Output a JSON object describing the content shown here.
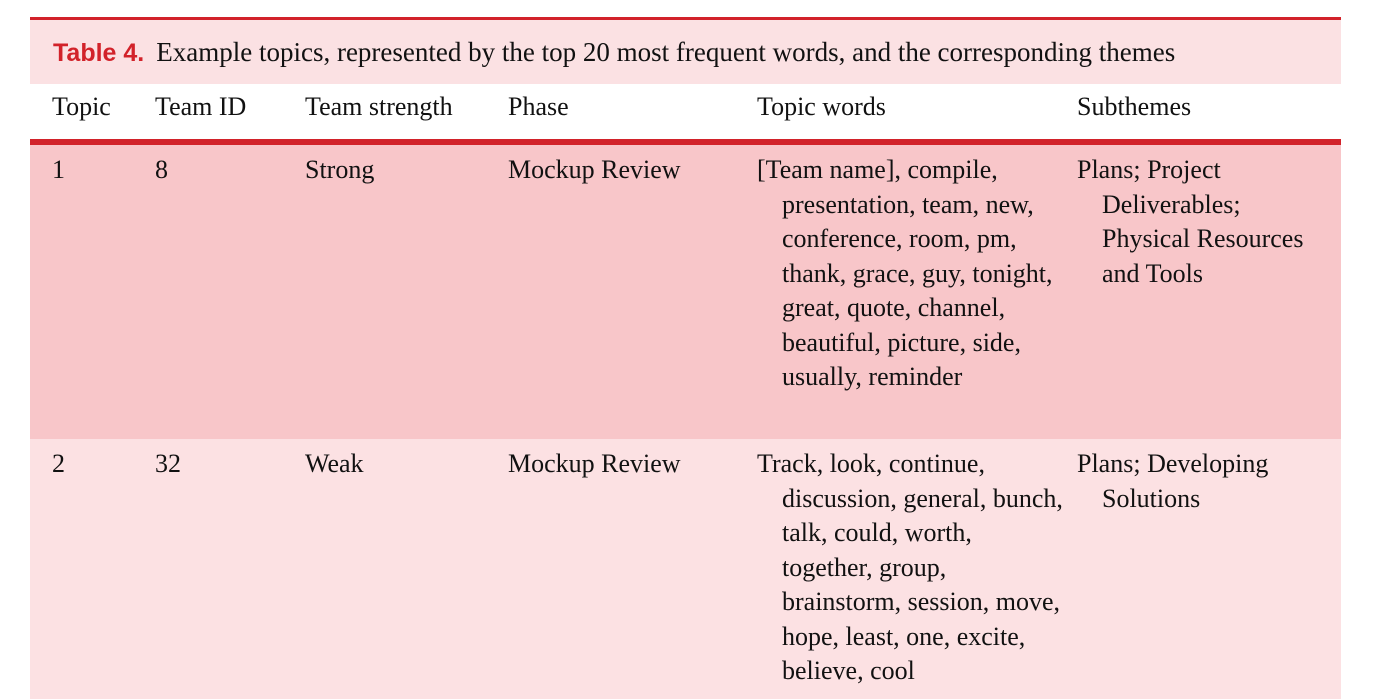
{
  "caption": {
    "label": "Table 4.",
    "text": "Example topics, represented by the top 20 most frequent words, and the corresponding themes"
  },
  "colors": {
    "accent_red": "#d2222a",
    "caption_bg": "#fbe1e3",
    "row_odd_bg": "#f8c6c9",
    "row_even_bg": "#fce1e3"
  },
  "columns": [
    "Topic",
    "Team ID",
    "Team strength",
    "Phase",
    "Topic words",
    "Subthemes"
  ],
  "rows": [
    {
      "topic": "1",
      "team_id": "8",
      "team_strength": "Strong",
      "phase": "Mockup Review",
      "topic_words": "[Team name], compile, presentation, team, new, conference, room, pm, thank, grace, guy, tonight, great, quote, channel, beautiful, picture, side, usually, reminder",
      "subthemes": "Plans; Project Deliverables; Physical Resources and Tools"
    },
    {
      "topic": "2",
      "team_id": "32",
      "team_strength": "Weak",
      "phase": "Mockup Review",
      "topic_words": "Track, look, continue, discussion, general, bunch, talk, could, worth, together, group, brainstorm, session, move, hope, least, one, excite, believe, cool",
      "subthemes": "Plans; Developing Solutions"
    }
  ]
}
